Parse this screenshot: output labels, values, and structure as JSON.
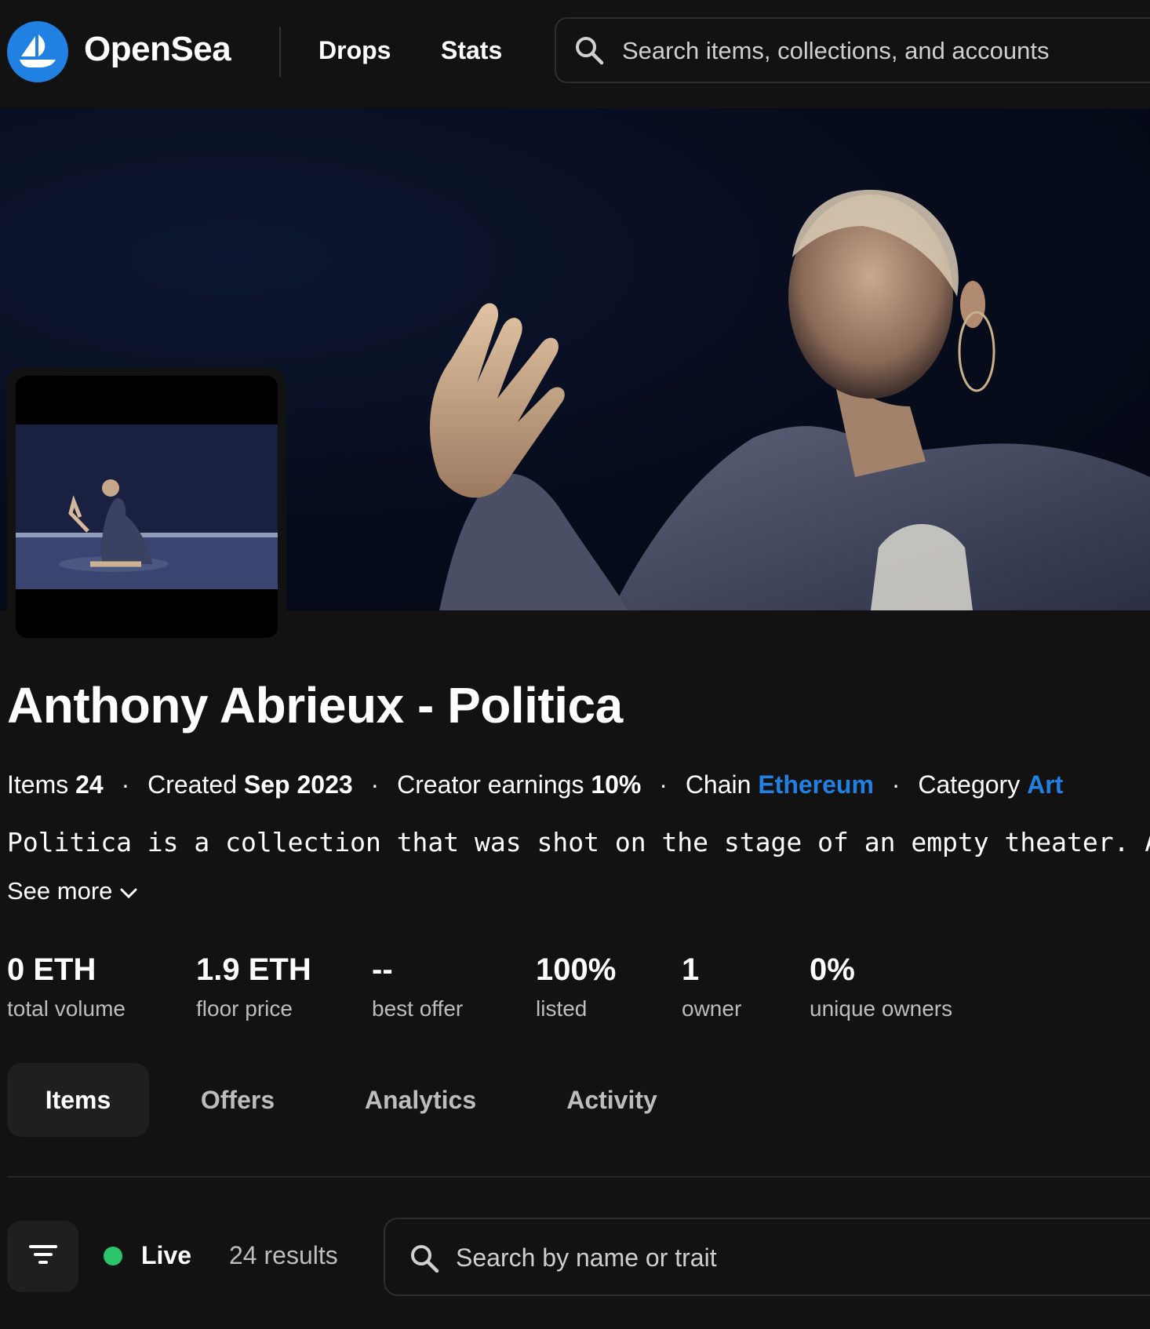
{
  "nav": {
    "brand": "OpenSea",
    "links": [
      "Drops",
      "Stats"
    ],
    "search_placeholder": "Search items, collections, and accounts"
  },
  "collection": {
    "name": "Anthony Abrieux - Politica",
    "meta": {
      "items_label": "Items",
      "items_value": "24",
      "created_label": "Created",
      "created_value": "Sep 2023",
      "earnings_label": "Creator earnings",
      "earnings_value": "10%",
      "chain_label": "Chain",
      "chain_value": "Ethereum",
      "category_label": "Category",
      "category_value": "Art",
      "separator": "·"
    },
    "description": "Politica is a collection that was shot on the stage of an empty theater. As",
    "see_more": "See more"
  },
  "stats": [
    {
      "value": "0 ETH",
      "label": "total volume"
    },
    {
      "value": "1.9 ETH",
      "label": "floor price"
    },
    {
      "value": "--",
      "label": "best offer"
    },
    {
      "value": "100%",
      "label": "listed"
    },
    {
      "value": "1",
      "label": "owner"
    },
    {
      "value": "0%",
      "label": "unique owners"
    }
  ],
  "tabs": [
    {
      "label": "Items",
      "active": true
    },
    {
      "label": "Offers",
      "active": false
    },
    {
      "label": "Analytics",
      "active": false
    },
    {
      "label": "Activity",
      "active": false
    }
  ],
  "filter_bar": {
    "status": "Live",
    "status_color": "#2bc46b",
    "results": "24 results",
    "search_placeholder": "Search by name or trait"
  },
  "colors": {
    "background": "#121212",
    "accent": "#2081e2",
    "muted_text": "#bdbdbd"
  },
  "icons": [
    "opensea-logo-icon",
    "search-icon",
    "chevron-down-icon",
    "filter-icon"
  ]
}
